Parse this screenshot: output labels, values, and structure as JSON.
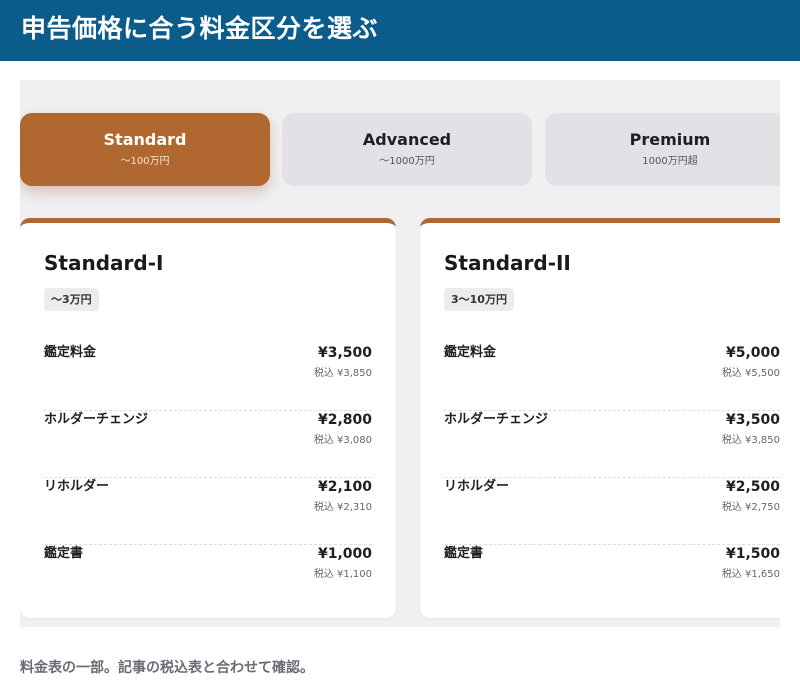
{
  "header": {
    "title": "申告価格に合う料金区分を選ぶ"
  },
  "tabs": [
    {
      "label": "Standard",
      "sub": "〜100万円",
      "active": true
    },
    {
      "label": "Advanced",
      "sub": "〜1000万円",
      "active": false
    },
    {
      "label": "Premium",
      "sub": "1000万円超",
      "active": false
    }
  ],
  "cards": [
    {
      "title": "Standard-I",
      "range": "〜3万円",
      "rows": [
        {
          "name": "鑑定料金",
          "price": "¥3,500",
          "tax": "税込 ¥3,850"
        },
        {
          "name": "ホルダーチェンジ",
          "price": "¥2,800",
          "tax": "税込 ¥3,080"
        },
        {
          "name": "リホルダー",
          "price": "¥2,100",
          "tax": "税込 ¥2,310"
        },
        {
          "name": "鑑定書",
          "price": "¥1,000",
          "tax": "税込 ¥1,100"
        }
      ]
    },
    {
      "title": "Standard-II",
      "range": "3〜10万円",
      "rows": [
        {
          "name": "鑑定料金",
          "price": "¥5,000",
          "tax": "税込 ¥5,500"
        },
        {
          "name": "ホルダーチェンジ",
          "price": "¥3,500",
          "tax": "税込 ¥3,850"
        },
        {
          "name": "リホルダー",
          "price": "¥2,500",
          "tax": "税込 ¥2,750"
        },
        {
          "name": "鑑定書",
          "price": "¥1,500",
          "tax": "税込 ¥1,650"
        }
      ]
    }
  ],
  "caption": "料金表の一部。記事の税込表と合わせて確認。",
  "colors": {
    "header": "#0b5c8a",
    "accent": "#b06830",
    "stage": "#f0f0f3"
  }
}
